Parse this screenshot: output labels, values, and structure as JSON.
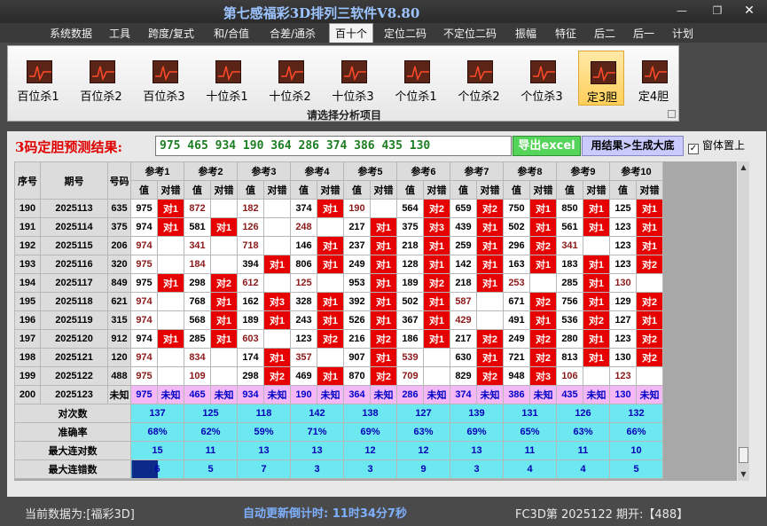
{
  "window": {
    "title": "第七感福彩3D排列三软件V8.80",
    "min": "—",
    "max": "❐",
    "close": "✕"
  },
  "menu": [
    "系统数据",
    "工具",
    "跨度/复式",
    "和/合值",
    "合差/通杀",
    "百十个",
    "定位二码",
    "不定位二码",
    "振幅",
    "特征",
    "后二",
    "后一",
    "计划"
  ],
  "menu_active": "百十个",
  "ribbon": {
    "buttons": [
      "百位杀1",
      "百位杀2",
      "百位杀3",
      "十位杀1",
      "十位杀2",
      "十位杀3",
      "个位杀1",
      "个位杀2",
      "个位杀3",
      "定3胆",
      "定4胆"
    ],
    "selected": "定3胆",
    "caption": "请选择分析项目"
  },
  "result": {
    "label": "3码定胆预测结果:",
    "value": "975 465 934 190 364 286 374 386 435 130",
    "export_label": "导出excel",
    "generate_label": "用结果>生成大底",
    "pin_label": "窗体置上",
    "pin_checked": true
  },
  "table": {
    "head": {
      "seq": "序号",
      "period": "期号",
      "num": "号码",
      "val": "值",
      "hit": "对错"
    },
    "refs": [
      "参考1",
      "参考2",
      "参考3",
      "参考4",
      "参考5",
      "参考6",
      "参考7",
      "参考8",
      "参考9",
      "参考10"
    ],
    "rows": [
      {
        "seq": "190",
        "period": "2025113",
        "num": "635",
        "cells": [
          [
            "975",
            "对1"
          ],
          [
            "872",
            ""
          ],
          [
            "182",
            ""
          ],
          [
            "374",
            "对1"
          ],
          [
            "190",
            ""
          ],
          [
            "564",
            "对2"
          ],
          [
            "659",
            "对2"
          ],
          [
            "750",
            "对1"
          ],
          [
            "850",
            "对1"
          ],
          [
            "125",
            "对1"
          ]
        ]
      },
      {
        "seq": "191",
        "period": "2025114",
        "num": "375",
        "cells": [
          [
            "974",
            "对1"
          ],
          [
            "581",
            "对1"
          ],
          [
            "126",
            ""
          ],
          [
            "248",
            ""
          ],
          [
            "217",
            "对1"
          ],
          [
            "375",
            "对3"
          ],
          [
            "439",
            "对1"
          ],
          [
            "502",
            "对1"
          ],
          [
            "561",
            "对1"
          ],
          [
            "123",
            "对1"
          ]
        ]
      },
      {
        "seq": "192",
        "period": "2025115",
        "num": "206",
        "cells": [
          [
            "974",
            ""
          ],
          [
            "341",
            ""
          ],
          [
            "718",
            ""
          ],
          [
            "146",
            "对1"
          ],
          [
            "237",
            "对1"
          ],
          [
            "218",
            "对1"
          ],
          [
            "259",
            "对1"
          ],
          [
            "296",
            "对2"
          ],
          [
            "341",
            ""
          ],
          [
            "123",
            "对1"
          ]
        ]
      },
      {
        "seq": "193",
        "period": "2025116",
        "num": "320",
        "cells": [
          [
            "975",
            ""
          ],
          [
            "184",
            ""
          ],
          [
            "394",
            "对1"
          ],
          [
            "806",
            "对1"
          ],
          [
            "249",
            "对1"
          ],
          [
            "128",
            "对1"
          ],
          [
            "142",
            "对1"
          ],
          [
            "163",
            "对1"
          ],
          [
            "183",
            "对1"
          ],
          [
            "123",
            "对2"
          ]
        ]
      },
      {
        "seq": "194",
        "period": "2025117",
        "num": "849",
        "cells": [
          [
            "975",
            "对1"
          ],
          [
            "298",
            "对2"
          ],
          [
            "612",
            ""
          ],
          [
            "125",
            ""
          ],
          [
            "953",
            "对1"
          ],
          [
            "189",
            "对2"
          ],
          [
            "218",
            "对1"
          ],
          [
            "253",
            ""
          ],
          [
            "285",
            "对1"
          ],
          [
            "130",
            ""
          ]
        ]
      },
      {
        "seq": "195",
        "period": "2025118",
        "num": "621",
        "cells": [
          [
            "974",
            ""
          ],
          [
            "768",
            "对1"
          ],
          [
            "162",
            "对3"
          ],
          [
            "328",
            "对1"
          ],
          [
            "392",
            "对1"
          ],
          [
            "502",
            "对1"
          ],
          [
            "587",
            ""
          ],
          [
            "671",
            "对2"
          ],
          [
            "756",
            "对1"
          ],
          [
            "129",
            "对2"
          ]
        ]
      },
      {
        "seq": "196",
        "period": "2025119",
        "num": "315",
        "cells": [
          [
            "974",
            ""
          ],
          [
            "568",
            "对1"
          ],
          [
            "189",
            "对1"
          ],
          [
            "243",
            "对1"
          ],
          [
            "526",
            "对1"
          ],
          [
            "367",
            "对1"
          ],
          [
            "429",
            ""
          ],
          [
            "491",
            "对1"
          ],
          [
            "536",
            "对2"
          ],
          [
            "127",
            "对1"
          ]
        ]
      },
      {
        "seq": "197",
        "period": "2025120",
        "num": "912",
        "cells": [
          [
            "974",
            "对1"
          ],
          [
            "285",
            "对1"
          ],
          [
            "603",
            ""
          ],
          [
            "123",
            "对2"
          ],
          [
            "216",
            "对2"
          ],
          [
            "186",
            "对1"
          ],
          [
            "217",
            "对2"
          ],
          [
            "249",
            "对2"
          ],
          [
            "280",
            "对1"
          ],
          [
            "123",
            "对2"
          ]
        ]
      },
      {
        "seq": "198",
        "period": "2025121",
        "num": "120",
        "cells": [
          [
            "974",
            ""
          ],
          [
            "834",
            ""
          ],
          [
            "174",
            "对1"
          ],
          [
            "357",
            ""
          ],
          [
            "907",
            "对1"
          ],
          [
            "539",
            ""
          ],
          [
            "630",
            "对1"
          ],
          [
            "721",
            "对2"
          ],
          [
            "813",
            "对1"
          ],
          [
            "130",
            "对2"
          ]
        ]
      },
      {
        "seq": "199",
        "period": "2025122",
        "num": "488",
        "cells": [
          [
            "975",
            ""
          ],
          [
            "109",
            ""
          ],
          [
            "298",
            "对2"
          ],
          [
            "469",
            "对1"
          ],
          [
            "870",
            "对2"
          ],
          [
            "709",
            ""
          ],
          [
            "829",
            "对2"
          ],
          [
            "948",
            "对3"
          ],
          [
            "106",
            ""
          ],
          [
            "123",
            ""
          ]
        ]
      },
      {
        "seq": "200",
        "period": "2025123",
        "num": "未知",
        "cells": [
          [
            "975",
            "未知"
          ],
          [
            "465",
            "未知"
          ],
          [
            "934",
            "未知"
          ],
          [
            "190",
            "未知"
          ],
          [
            "364",
            "未知"
          ],
          [
            "286",
            "未知"
          ],
          [
            "374",
            "未知"
          ],
          [
            "386",
            "未知"
          ],
          [
            "435",
            "未知"
          ],
          [
            "130",
            "未知"
          ]
        ]
      }
    ],
    "stats": [
      {
        "label": "对次数",
        "values": [
          "137",
          "125",
          "118",
          "142",
          "138",
          "127",
          "139",
          "131",
          "126",
          "132"
        ]
      },
      {
        "label": "准确率",
        "values": [
          "68%",
          "62%",
          "59%",
          "71%",
          "69%",
          "63%",
          "69%",
          "65%",
          "63%",
          "66%"
        ]
      },
      {
        "label": "最大连对数",
        "values": [
          "15",
          "11",
          "13",
          "13",
          "12",
          "12",
          "13",
          "11",
          "11",
          "10"
        ]
      },
      {
        "label": "最大连错数",
        "values": [
          "6",
          "5",
          "7",
          "3",
          "3",
          "9",
          "3",
          "4",
          "4",
          "5"
        ]
      }
    ]
  },
  "status": {
    "data_source": "当前数据为:[福彩3D]",
    "countdown": "自动更新倒计时:  11时34分7秒",
    "issue": "FC3D第 2025122 期开:【488】"
  },
  "colors": {
    "hit": "#e60000",
    "stats": "#6ee8f0",
    "forecast_row": "#f3b8f5",
    "result_text": "#1d7d22"
  }
}
